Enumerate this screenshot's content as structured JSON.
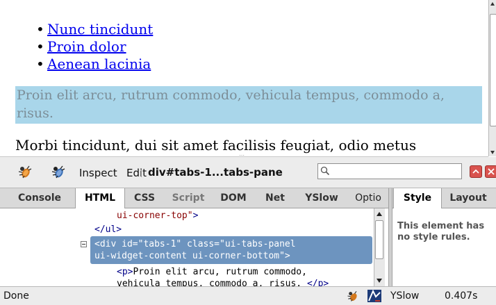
{
  "page": {
    "list_items": [
      "Nunc tincidunt",
      "Proin dolor",
      "Aenean lacinia"
    ],
    "highlight_text": "Proin elit arcu, rutrum commodo, vehicula tempus, commodo a, risus.",
    "paragraph_text": "Morbi tincidunt, dui sit amet facilisis feugiat, odio metus"
  },
  "toolbar": {
    "inspect_label": "Inspect",
    "edit_label": "Edit",
    "breadcrumb": "div#tabs-1...tabs-pane",
    "search_value": "",
    "search_placeholder": ""
  },
  "tabs": [
    "Console",
    "HTML",
    "CSS",
    "Script",
    "DOM",
    "Net",
    "YSlow",
    "Optio"
  ],
  "active_tab": "HTML",
  "side_tabs": [
    "Style",
    "Layout"
  ],
  "code": {
    "line1_val": "ui-corner-top\"",
    "line1_end": ">",
    "line2": "</ul>",
    "sel_line1": "<div id=\"tabs-1\" class=\"ui-tabs-panel",
    "sel_line2": "ui-widget-content ui-corner-bottom\">",
    "line3_tag": "<p>",
    "line3_text": "Proin elit arcu, rutrum commodo,",
    "line4_text": "vehicula tempus, commodo a, risus.",
    "line4_tag": "</p>"
  },
  "style_panel": {
    "message": "This element has no style rules."
  },
  "status": {
    "left": "Done",
    "yslow_label": "YSlow",
    "time": "0.407s"
  },
  "colors": {
    "highlight_bg": "#a9d6ea",
    "selection_bg": "#6d94bf",
    "link": "#0000ee"
  }
}
